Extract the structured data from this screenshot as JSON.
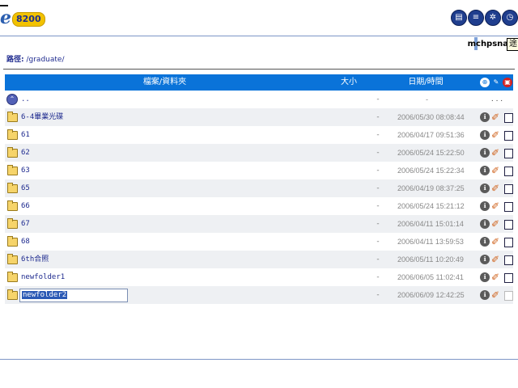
{
  "header": {
    "logo_letter": "e",
    "logo_model": "8200",
    "icons": [
      "printer-icon",
      "list-icon",
      "help-icon",
      "clock-icon"
    ],
    "user": "mchpsnas",
    "tooltip": "途"
  },
  "path": {
    "label": "路徑:",
    "value": "/graduate/"
  },
  "table": {
    "columns": [
      "檔案/資料夾",
      "大小",
      "日期/時間"
    ],
    "parent": {
      "name": "..",
      "size": "-",
      "date": "-",
      "actions": ". . ."
    },
    "rows": [
      {
        "name": "6-4畢業光碟",
        "size": "-",
        "date": "2006/05/30 08:08:44"
      },
      {
        "name": "61",
        "size": "-",
        "date": "2006/04/17 09:51:36"
      },
      {
        "name": "62",
        "size": "-",
        "date": "2006/05/24 15:22:50"
      },
      {
        "name": "63",
        "size": "-",
        "date": "2006/05/24 15:22:34"
      },
      {
        "name": "65",
        "size": "-",
        "date": "2006/04/19 08:37:25"
      },
      {
        "name": "66",
        "size": "-",
        "date": "2006/05/24 15:21:12"
      },
      {
        "name": "67",
        "size": "-",
        "date": "2006/04/11 15:01:14"
      },
      {
        "name": "68",
        "size": "-",
        "date": "2006/04/11 13:59:53"
      },
      {
        "name": "6th合照",
        "size": "-",
        "date": "2006/05/11 10:20:49"
      },
      {
        "name": "newfolder1",
        "size": "-",
        "date": "2006/06/05 11:02:41"
      }
    ],
    "editing_row": {
      "value": "newfolder2",
      "size": "-",
      "date": "2006/06/09 12:42:25"
    }
  },
  "colors": {
    "header_bg": "#0a73d9",
    "alt_row": "#eef0f3",
    "link": "#1f2b8f"
  }
}
